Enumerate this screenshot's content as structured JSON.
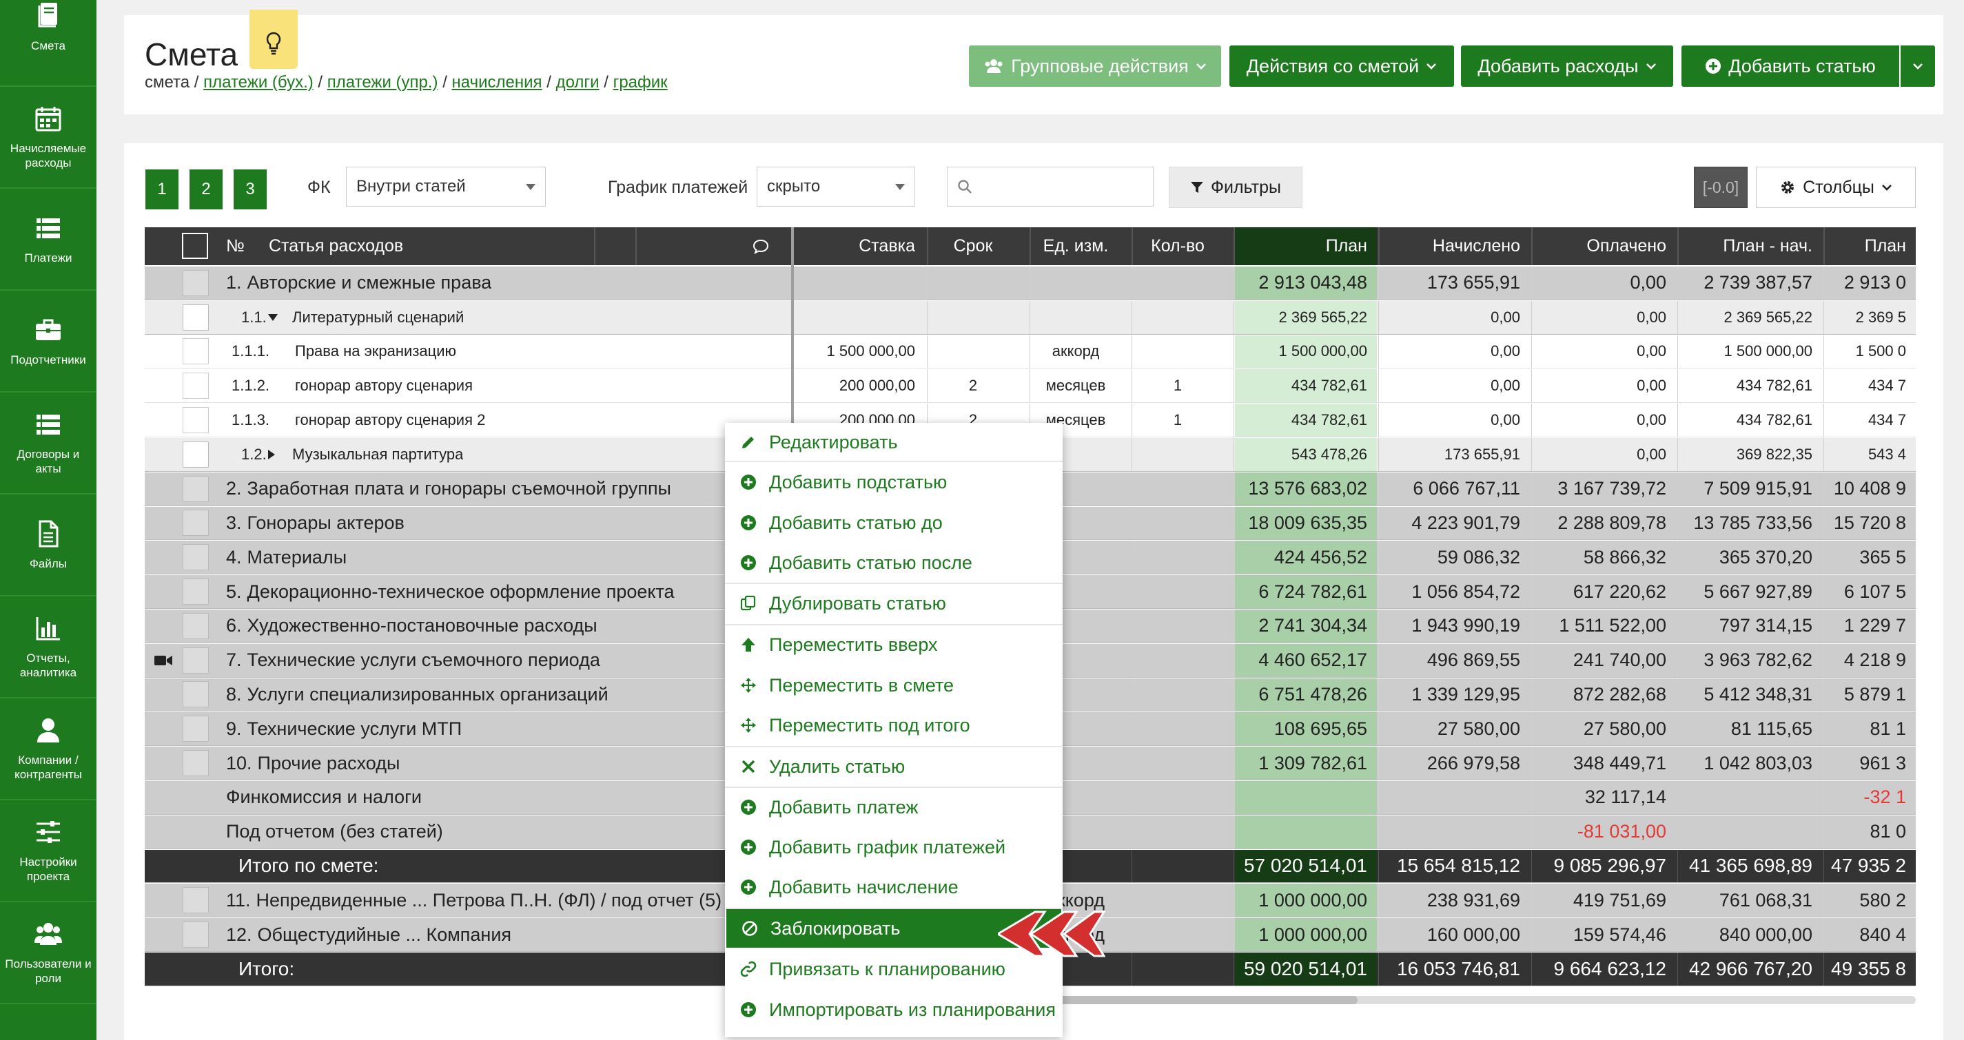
{
  "sidebar": {
    "items": [
      {
        "label": "Смета",
        "icon": "book-icon"
      },
      {
        "label": "Начисляемые расходы",
        "icon": "calendar-icon"
      },
      {
        "label": "Платежи",
        "icon": "list-icon"
      },
      {
        "label": "Подотчетники",
        "icon": "briefcase-icon"
      },
      {
        "label": "Договоры и акты",
        "icon": "list-icon"
      },
      {
        "label": "Файлы",
        "icon": "file-icon"
      },
      {
        "label": "Отчеты, аналитика",
        "icon": "bar-chart-icon"
      },
      {
        "label": "Компании / контрагенты",
        "icon": "user-icon"
      },
      {
        "label": "Настройки проекта",
        "icon": "sliders-icon"
      },
      {
        "label": "Пользователи и роли",
        "icon": "users-icon"
      }
    ]
  },
  "header": {
    "title": "Смета",
    "breadcrumb": {
      "current": "смета",
      "links": [
        "платежи (бух.)",
        "платежи (упр.)",
        "начисления",
        "долги",
        "график"
      ],
      "sep": " / "
    },
    "buttons": {
      "group": "Групповые действия",
      "estimate": "Действия со сметой",
      "expenses": "Добавить расходы",
      "add_item": "Добавить статью"
    }
  },
  "toolbar": {
    "pages": [
      "1",
      "2",
      "3"
    ],
    "fk_label": "ФК",
    "fk_value": "Внутри статей",
    "schedule_label": "График платежей",
    "schedule_value": "скрыто",
    "search_placeholder": "",
    "filters": "Фильтры",
    "counter": "[-0.0]",
    "columns": "Столбцы"
  },
  "table": {
    "headers": {
      "num": "№",
      "name": "Статья расходов",
      "rate": "Ставка",
      "term": "Срок",
      "unit": "Ед. изм.",
      "qty": "Кол-во",
      "plan": "План",
      "accrued": "Начислено",
      "paid": "Оплачено",
      "plan_acc": "План - нач.",
      "plan2": "План"
    },
    "rows": [
      {
        "type": "cat",
        "num": "1.",
        "name": "Авторские и смежные права",
        "rate": "",
        "term": "",
        "unit": "",
        "qty": "",
        "plan": "2 913 043,48",
        "accrued": "173 655,91",
        "paid": "0,00",
        "diff": "2 739 387,57",
        "plan2": "2 913 0"
      },
      {
        "type": "sub",
        "num": "1.1.",
        "name": "Литературный сценарий",
        "arrow": "down",
        "rate": "",
        "term": "",
        "unit": "",
        "qty": "",
        "plan": "2 369 565,22",
        "accrued": "0,00",
        "paid": "0,00",
        "diff": "2 369 565,22",
        "plan2": "2 369 5"
      },
      {
        "type": "item",
        "num": "1.1.1.",
        "name": "Права на экранизацию",
        "rate": "1 500 000,00",
        "term": "",
        "unit": "аккорд",
        "qty": "",
        "plan": "1 500 000,00",
        "accrued": "0,00",
        "paid": "0,00",
        "diff": "1 500 000,00",
        "plan2": "1 500 0"
      },
      {
        "type": "item",
        "num": "1.1.2.",
        "name": "гонорар автору сценария",
        "rate": "200 000,00",
        "term": "2",
        "unit": "месяцев",
        "qty": "1",
        "plan": "434 782,61",
        "accrued": "0,00",
        "paid": "0,00",
        "diff": "434 782,61",
        "plan2": "434 7"
      },
      {
        "type": "item",
        "num": "1.1.3.",
        "name": "гонорар автору сценария 2",
        "rate": "200 000,00",
        "term": "2",
        "unit": "месяцев",
        "qty": "1",
        "plan": "434 782,61",
        "accrued": "0,00",
        "paid": "0,00",
        "diff": "434 782,61",
        "plan2": "434 7"
      },
      {
        "type": "sub",
        "num": "1.2.",
        "name": "Музыкальная партитура",
        "arrow": "right",
        "rate": "",
        "term": "",
        "unit": "",
        "qty": "",
        "plan": "543 478,26",
        "accrued": "173 655,91",
        "paid": "0,00",
        "diff": "369 822,35",
        "plan2": "543 4"
      },
      {
        "type": "cat",
        "num": "2.",
        "name": "Заработная плата и гонорары съемочной группы",
        "rate": "",
        "term": "",
        "unit": "",
        "qty": "",
        "plan": "13 576 683,02",
        "accrued": "6 066 767,11",
        "paid": "3 167 739,72",
        "diff": "7 509 915,91",
        "plan2": "10 408 9"
      },
      {
        "type": "cat",
        "num": "3.",
        "name": "Гонорары актеров",
        "rate": "",
        "term": "",
        "unit": "",
        "qty": "",
        "plan": "18 009 635,35",
        "accrued": "4 223 901,79",
        "paid": "2 288 809,78",
        "diff": "13 785 733,56",
        "plan2": "15 720 8"
      },
      {
        "type": "cat",
        "num": "4.",
        "name": "Материалы",
        "rate": "",
        "term": "",
        "unit": "",
        "qty": "",
        "plan": "424 456,52",
        "accrued": "59 086,32",
        "paid": "58 866,32",
        "diff": "365 370,20",
        "plan2": "365 5"
      },
      {
        "type": "cat",
        "num": "5.",
        "name": "Декорационно-техническое оформление проекта",
        "rate": "",
        "term": "",
        "unit": "",
        "qty": "",
        "plan": "6 724 782,61",
        "accrued": "1 056 854,72",
        "paid": "617 220,62",
        "diff": "5 667 927,89",
        "plan2": "6 107 5"
      },
      {
        "type": "cat",
        "num": "6.",
        "name": "Художественно-постановочные расходы",
        "rate": "",
        "term": "",
        "unit": "",
        "qty": "",
        "plan": "2 741 304,34",
        "accrued": "1 943 990,19",
        "paid": "1 511 522,00",
        "diff": "797 314,15",
        "plan2": "1 229 7"
      },
      {
        "type": "cat",
        "num": "7.",
        "name": "Технические услуги съемочного периода",
        "camera": true,
        "rate": "",
        "term": "",
        "unit": "",
        "qty": "",
        "plan": "4 460 652,17",
        "accrued": "496 869,55",
        "paid": "241 740,00",
        "diff": "3 963 782,62",
        "plan2": "4 218 9"
      },
      {
        "type": "cat",
        "num": "8.",
        "name": "Услуги специализированных организаций",
        "rate": "",
        "term": "",
        "unit": "",
        "qty": "",
        "plan": "6 751 478,26",
        "accrued": "1 339 129,95",
        "paid": "872 282,68",
        "diff": "5 412 348,31",
        "plan2": "5 879 1"
      },
      {
        "type": "cat",
        "num": "9.",
        "name": "Технические услуги МТП",
        "rate": "",
        "term": "",
        "unit": "",
        "qty": "",
        "plan": "108 695,65",
        "accrued": "27 580,00",
        "paid": "27 580,00",
        "diff": "81 115,65",
        "plan2": "81 1"
      },
      {
        "type": "cat",
        "num": "10.",
        "name": "Прочие расходы",
        "rate": "",
        "term": "",
        "unit": "",
        "qty": "",
        "plan": "1 309 782,61",
        "accrued": "266 979,58",
        "paid": "348 449,71",
        "diff": "1 042 803,03",
        "plan2": "961 3"
      },
      {
        "type": "misc",
        "num": "",
        "name": "Финкомиссия и налоги",
        "rate": "",
        "term": "",
        "unit": "",
        "qty": "",
        "plan": "",
        "accrued": "",
        "paid": "32 117,14",
        "diff": "",
        "plan2": "-32 1"
      },
      {
        "type": "misc",
        "num": "",
        "name": "Под отчетом (без статей)",
        "rate": "",
        "term": "",
        "unit": "",
        "qty": "",
        "plan": "",
        "accrued": "",
        "paid": "-81 031,00",
        "diff": "",
        "plan2": "81 0"
      },
      {
        "type": "total",
        "num": "",
        "name": "Итого по смете:",
        "rate": "",
        "term": "",
        "unit": "",
        "qty": "",
        "plan": "57 020 514,01",
        "accrued": "15 654 815,12",
        "paid": "9 085 296,97",
        "diff": "41 365 698,89",
        "plan2": "47 935 2"
      },
      {
        "type": "cat",
        "num": "11.",
        "name": "Непредвиденные ... Петрова П..Н. (ФЛ) / под отчет (5)",
        "rate": "",
        "term": "",
        "unit": "аккорд",
        "qty": "",
        "plan": "1 000 000,00",
        "accrued": "238 931,69",
        "paid": "419 751,69",
        "diff": "761 068,31",
        "plan2": "580 2"
      },
      {
        "type": "cat",
        "num": "12.",
        "name": "Общестудийные ... Компания",
        "rate": "",
        "term": "",
        "unit": "аккорд",
        "qty": "",
        "plan": "1 000 000,00",
        "accrued": "160 000,00",
        "paid": "159 574,46",
        "diff": "840 000,00",
        "plan2": "840 4"
      },
      {
        "type": "total",
        "num": "",
        "name": "Итого:",
        "rate": "",
        "term": "",
        "unit": "",
        "qty": "",
        "plan": "59 020 514,01",
        "accrued": "16 053 746,81",
        "paid": "9 664 623,12",
        "diff": "42 966 767,20",
        "plan2": "49 355 8"
      }
    ]
  },
  "context_menu": {
    "items": [
      {
        "label": "Редактировать",
        "icon": "pencil-icon"
      },
      {
        "label": "Добавить подстатью",
        "icon": "plus-circle-icon"
      },
      {
        "label": "Добавить статью до",
        "icon": "plus-circle-icon"
      },
      {
        "label": "Добавить статью после",
        "icon": "plus-circle-icon"
      },
      {
        "label": "Дублировать статью",
        "icon": "copy-icon"
      },
      {
        "label": "Переместить вверх",
        "icon": "arrow-up-icon"
      },
      {
        "label": "Переместить в смете",
        "icon": "move-icon"
      },
      {
        "label": "Переместить под итого",
        "icon": "move-icon"
      },
      {
        "label": "Удалить статью",
        "icon": "close-icon"
      },
      {
        "label": "Добавить платеж",
        "icon": "plus-circle-icon"
      },
      {
        "label": "Добавить график платежей",
        "icon": "plus-circle-icon"
      },
      {
        "label": "Добавить начисление",
        "icon": "plus-circle-icon"
      },
      {
        "label": "Заблокировать",
        "icon": "ban-icon"
      },
      {
        "label": "Привязать к планированию",
        "icon": "link-icon"
      },
      {
        "label": "Импортировать из планирования",
        "icon": "plus-circle-icon"
      }
    ]
  },
  "colors": {
    "brand": "#1e7a1e",
    "light_brand": "#7dbd7d",
    "plan_col": "#d5ecd5",
    "plan_col_cat": "#a8ceA8",
    "header": "#3a3a3a",
    "negative": "#e53935",
    "arrow": "#d32f2f"
  }
}
